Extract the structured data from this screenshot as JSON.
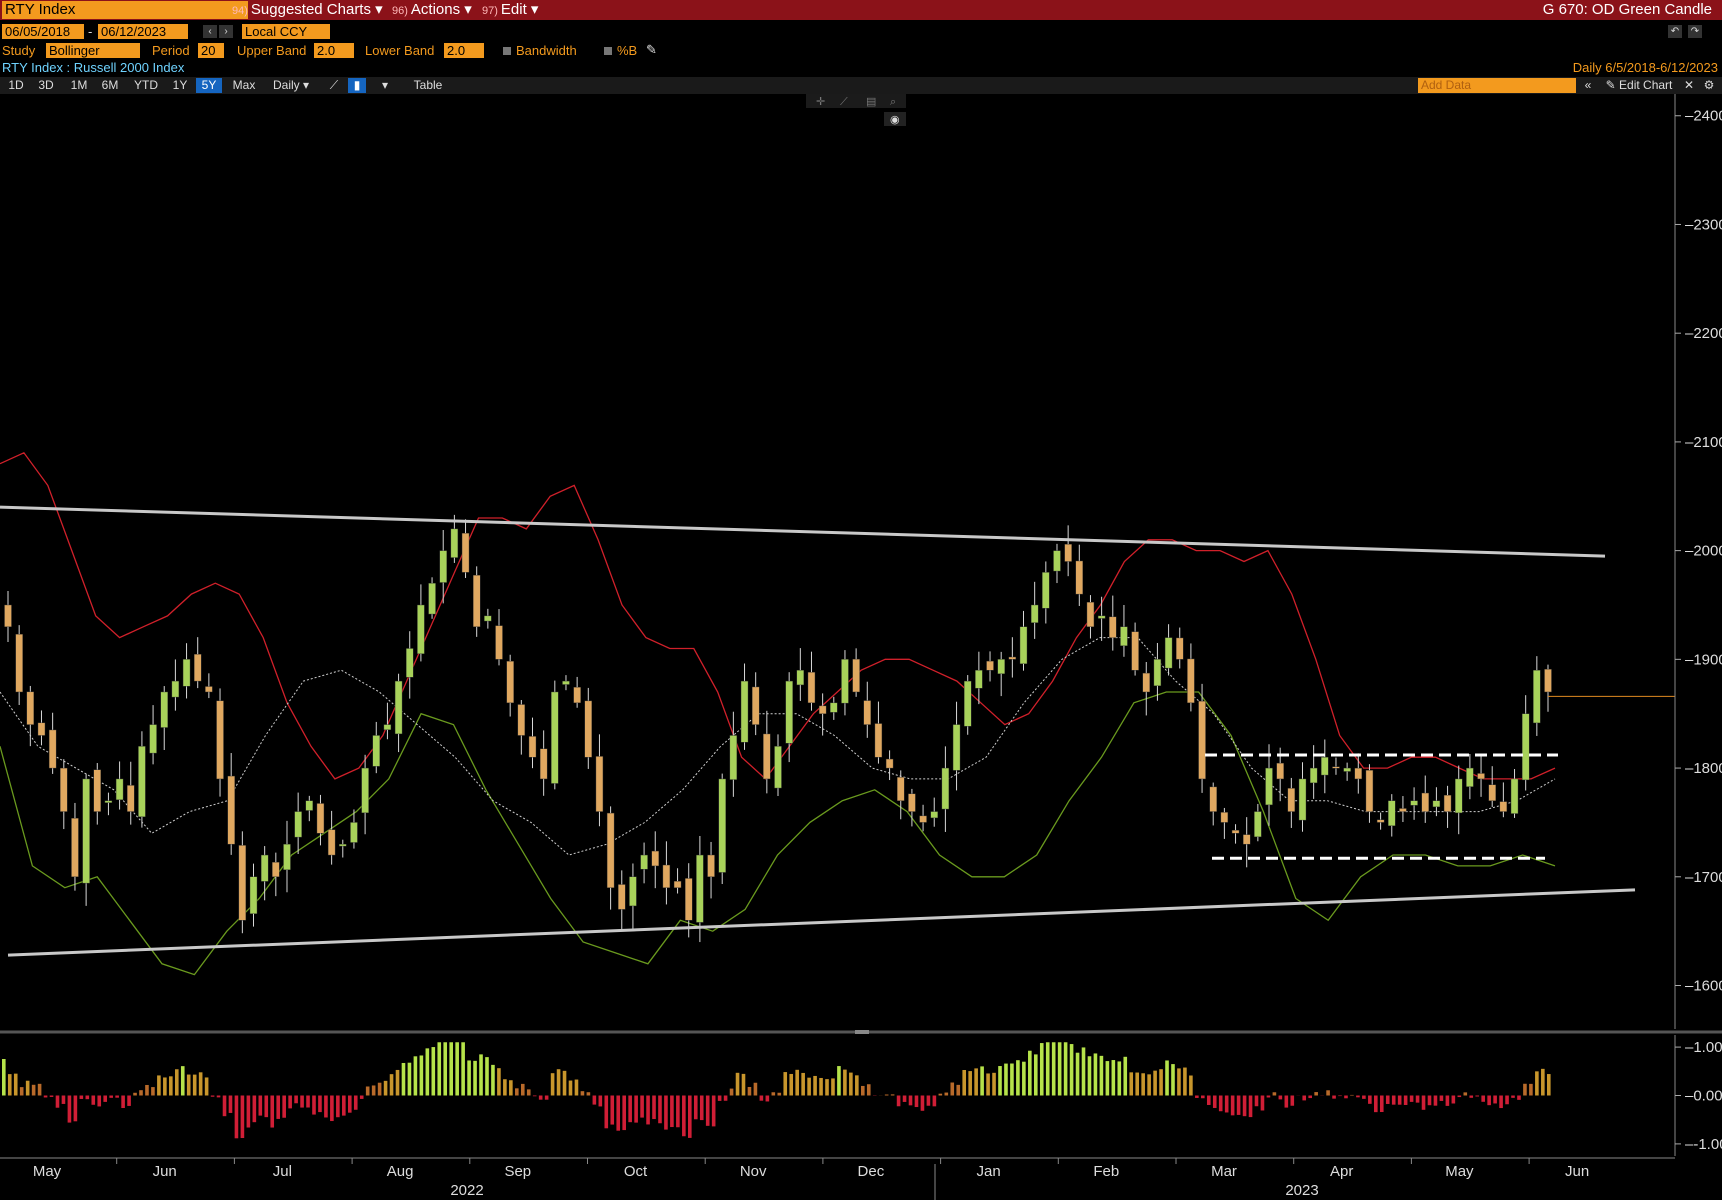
{
  "title_bar": {
    "ticker": "RTY Index",
    "menus": [
      {
        "num": "94)",
        "label": "Suggested Charts ▾"
      },
      {
        "num": "96)",
        "label": "Actions ▾"
      },
      {
        "num": "97)",
        "label": "Edit ▾"
      }
    ],
    "right": "G 670: OD Green Candle"
  },
  "controls": {
    "start_date": "06/05/2018",
    "dash": "-",
    "end_date": "06/12/2023",
    "currency": "Local CCY",
    "study_label": "Study",
    "study": "Bollinger",
    "period_label": "Period",
    "period": "20",
    "upper_label": "Upper Band",
    "upper": "2.0",
    "lower_label": "Lower Band",
    "lower": "2.0",
    "bandwidth": "Bandwidth",
    "pctb": "%B"
  },
  "security": {
    "name": "RTY Index : Russell 2000 Index",
    "range": "Daily   6/5/2018-6/12/2023"
  },
  "toolbar": {
    "periods": [
      "1D",
      "3D",
      "1M",
      "6M",
      "YTD",
      "1Y",
      "5Y",
      "Max"
    ],
    "active": "5Y",
    "frequency": "Daily ▾",
    "table": "Table",
    "add_data": "Add Data",
    "edit_chart": "Edit Chart"
  },
  "chart_data": {
    "type": "candlestick",
    "study": "Bollinger Bands (20, 2.0)",
    "y_axis": {
      "ticks": [
        1600,
        1700,
        1800,
        1900,
        2000,
        2100,
        2200,
        2300,
        2400
      ],
      "range": [
        1560,
        2420
      ]
    },
    "x_axis": {
      "months": [
        "May",
        "Jun",
        "Jul",
        "Aug",
        "Sep",
        "Oct",
        "Nov",
        "Dec",
        "Jan",
        "Feb",
        "Mar",
        "Apr",
        "May",
        "Jun"
      ],
      "years": [
        "2022",
        "2023"
      ]
    },
    "close_series": [
      1930,
      1870,
      1840,
      1830,
      1800,
      1760,
      1700,
      1790,
      1760,
      1770,
      1790,
      1760,
      1820,
      1840,
      1870,
      1880,
      1900,
      1880,
      1870,
      1790,
      1730,
      1660,
      1700,
      1720,
      1700,
      1730,
      1760,
      1770,
      1740,
      1720,
      1730,
      1750,
      1800,
      1830,
      1840,
      1880,
      1910,
      1950,
      1970,
      2000,
      2020,
      1980,
      1930,
      1940,
      1900,
      1860,
      1830,
      1810,
      1790,
      1870,
      1880,
      1860,
      1810,
      1760,
      1690,
      1670,
      1700,
      1720,
      1710,
      1690,
      1690,
      1660,
      1720,
      1700,
      1790,
      1830,
      1880,
      1840,
      1790,
      1820,
      1880,
      1890,
      1860,
      1850,
      1860,
      1900,
      1870,
      1840,
      1810,
      1800,
      1770,
      1760,
      1750,
      1760,
      1800,
      1840,
      1880,
      1890,
      1890,
      1900,
      1900,
      1930,
      1950,
      1980,
      2000,
      1990,
      1960,
      1930,
      1940,
      1920,
      1930,
      1890,
      1870,
      1900,
      1920,
      1900,
      1860,
      1790,
      1760,
      1750,
      1740,
      1730,
      1760,
      1800,
      1790,
      1760,
      1790,
      1800,
      1810,
      1800,
      1800,
      1790,
      1760,
      1750,
      1770,
      1760,
      1770,
      1760,
      1770,
      1760,
      1790,
      1800,
      1790,
      1770,
      1760,
      1790,
      1850,
      1890,
      1870
    ],
    "upper_band": [
      2080,
      2090,
      2060,
      2000,
      1940,
      1920,
      1930,
      1940,
      1960,
      1970,
      1960,
      1920,
      1860,
      1820,
      1790,
      1800,
      1830,
      1880,
      1930,
      1980,
      2030,
      2030,
      2020,
      2050,
      2060,
      2010,
      1950,
      1920,
      1910,
      1910,
      1870,
      1810,
      1790,
      1820,
      1850,
      1870,
      1890,
      1900,
      1900,
      1890,
      1880,
      1860,
      1840,
      1850,
      1880,
      1920,
      1950,
      1990,
      2010,
      2010,
      2000,
      2000,
      1990,
      2000,
      1960,
      1900,
      1830,
      1800,
      1800,
      1810,
      1810,
      1800,
      1790,
      1790,
      1790,
      1800
    ],
    "middle_band": [
      1870,
      1820,
      1800,
      1780,
      1740,
      1760,
      1770,
      1830,
      1880,
      1890,
      1870,
      1840,
      1810,
      1770,
      1750,
      1720,
      1730,
      1750,
      1780,
      1820,
      1850,
      1850,
      1830,
      1800,
      1790,
      1790,
      1810,
      1860,
      1900,
      1920,
      1920,
      1880,
      1850,
      1800,
      1770,
      1770,
      1760,
      1760,
      1760,
      1760,
      1770,
      1790
    ],
    "lower_band": [
      1820,
      1710,
      1690,
      1700,
      1660,
      1620,
      1610,
      1650,
      1680,
      1720,
      1740,
      1760,
      1790,
      1850,
      1840,
      1780,
      1730,
      1680,
      1640,
      1630,
      1620,
      1660,
      1650,
      1670,
      1720,
      1750,
      1770,
      1780,
      1760,
      1720,
      1700,
      1700,
      1720,
      1770,
      1810,
      1860,
      1870,
      1870,
      1830,
      1760,
      1680,
      1660,
      1700,
      1720,
      1720,
      1710,
      1710,
      1720,
      1710
    ],
    "trendlines": [
      {
        "name": "upper channel",
        "start": 2040,
        "end": 1995,
        "color": "#c8c8c8"
      },
      {
        "name": "lower channel",
        "start": 1628,
        "end": 1688,
        "color": "#c8c8c8"
      }
    ],
    "range_lines": [
      {
        "level": 1812,
        "style": "dashed",
        "color": "#ffffff"
      },
      {
        "level": 1717,
        "style": "dashed",
        "color": "#ffffff"
      }
    ],
    "last_price_line": 1866,
    "lower_panel": {
      "indicator": "%B oscillator",
      "ticks": [
        "1.00",
        "0.00",
        "-1.00"
      ],
      "range": [
        -1.25,
        1.25
      ]
    }
  }
}
